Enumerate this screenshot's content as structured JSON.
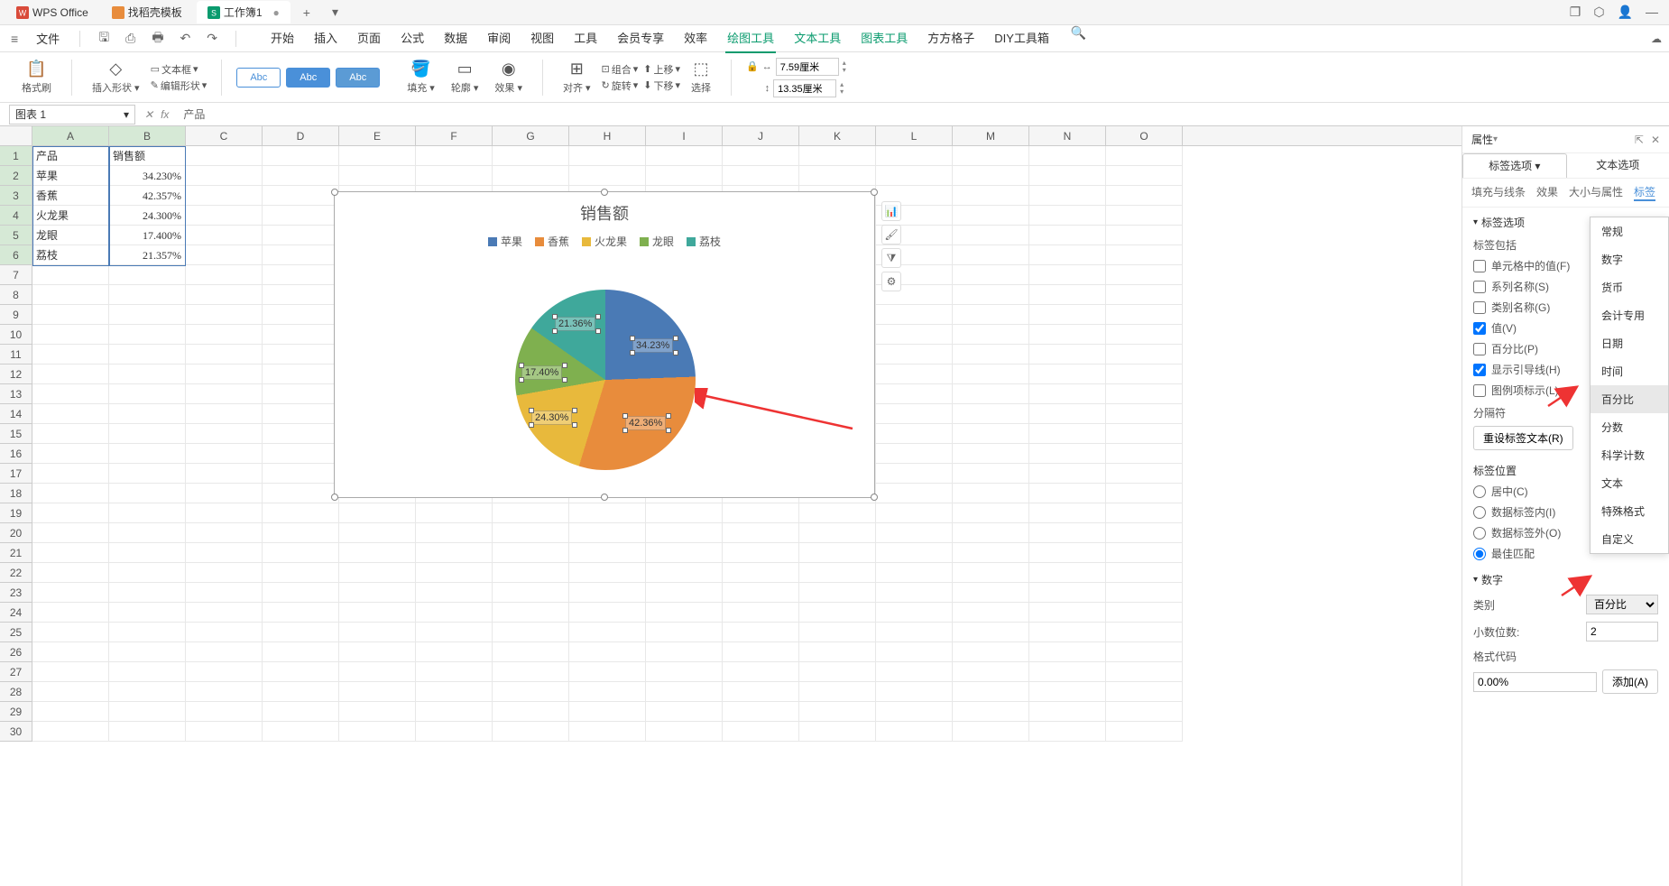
{
  "titlebar": {
    "app_name": "WPS Office",
    "tab1": "找稻壳模板",
    "tab2": "工作簿1",
    "add": "+"
  },
  "menubar": {
    "file": "文件",
    "tabs": [
      "开始",
      "插入",
      "页面",
      "公式",
      "数据",
      "审阅",
      "视图",
      "工具",
      "会员专享",
      "效率",
      "绘图工具",
      "文本工具",
      "图表工具",
      "方方格子",
      "DIY工具箱"
    ]
  },
  "ribbon": {
    "format_painter": "格式刷",
    "insert_shape": "插入形状",
    "text_frame": "文本框",
    "edit_shape": "编辑形状",
    "abc1": "Abc",
    "abc2": "Abc",
    "abc3": "Abc",
    "fill": "填充",
    "outline": "轮廓",
    "effect": "效果",
    "align": "对齐",
    "group": "组合",
    "rotate": "旋转",
    "move_up": "上移",
    "move_down": "下移",
    "select": "选择",
    "width": "7.59厘米",
    "height": "13.35厘米"
  },
  "formula": {
    "name_box": "图表 1",
    "formula_text": "产品"
  },
  "columns": [
    "A",
    "B",
    "C",
    "D",
    "E",
    "F",
    "G",
    "H",
    "I",
    "J",
    "K",
    "L",
    "M",
    "N",
    "O"
  ],
  "cells": {
    "a1": "产品",
    "b1": "销售额",
    "a2": "苹果",
    "b2": "34.230%",
    "a3": "香蕉",
    "b3": "42.357%",
    "a4": "火龙果",
    "b4": "24.300%",
    "a5": "龙眼",
    "b5": "17.400%",
    "a6": "荔枝",
    "b6": "21.357%"
  },
  "chart_data": {
    "type": "pie",
    "title": "销售额",
    "categories": [
      "苹果",
      "香蕉",
      "火龙果",
      "龙眼",
      "荔枝"
    ],
    "values": [
      34.23,
      42.36,
      24.3,
      17.4,
      21.36
    ],
    "labels": [
      "34.23%",
      "42.36%",
      "24.30%",
      "17.40%",
      "21.36%"
    ],
    "colors": [
      "#4a7ab5",
      "#e88c3c",
      "#e8b93c",
      "#7fb04f",
      "#3fa89b"
    ]
  },
  "panel": {
    "title": "属性",
    "tab_label": "标签选项",
    "tab_text": "文本选项",
    "subtabs": [
      "填充与线条",
      "效果",
      "大小与属性",
      "标签"
    ],
    "section_label_options": "标签选项",
    "label_includes": "标签包括",
    "cb_cell_value": "单元格中的值(F)",
    "cb_series_name": "系列名称(S)",
    "cb_category_name": "类别名称(G)",
    "cb_value": "值(V)",
    "cb_percent": "百分比(P)",
    "cb_leader_lines": "显示引导线(H)",
    "cb_legend_key": "图例项标示(L)",
    "separator": "分隔符",
    "reset_label": "重设标签文本(R)",
    "label_position": "标签位置",
    "rb_center": "居中(C)",
    "rb_inside": "数据标签内(I)",
    "rb_outside": "数据标签外(O)",
    "rb_bestfit": "最佳匹配",
    "section_number": "数字",
    "category_label": "类别",
    "category_value": "百分比",
    "decimal_label": "小数位数:",
    "decimal_value": "2",
    "format_code_label": "格式代码",
    "format_code_value": "0.00%",
    "add_btn": "添加(A)"
  },
  "format_dropdown": {
    "items": [
      "常规",
      "数字",
      "货币",
      "会计专用",
      "日期",
      "时间",
      "百分比",
      "分数",
      "科学计数",
      "文本",
      "特殊格式",
      "自定义"
    ]
  }
}
